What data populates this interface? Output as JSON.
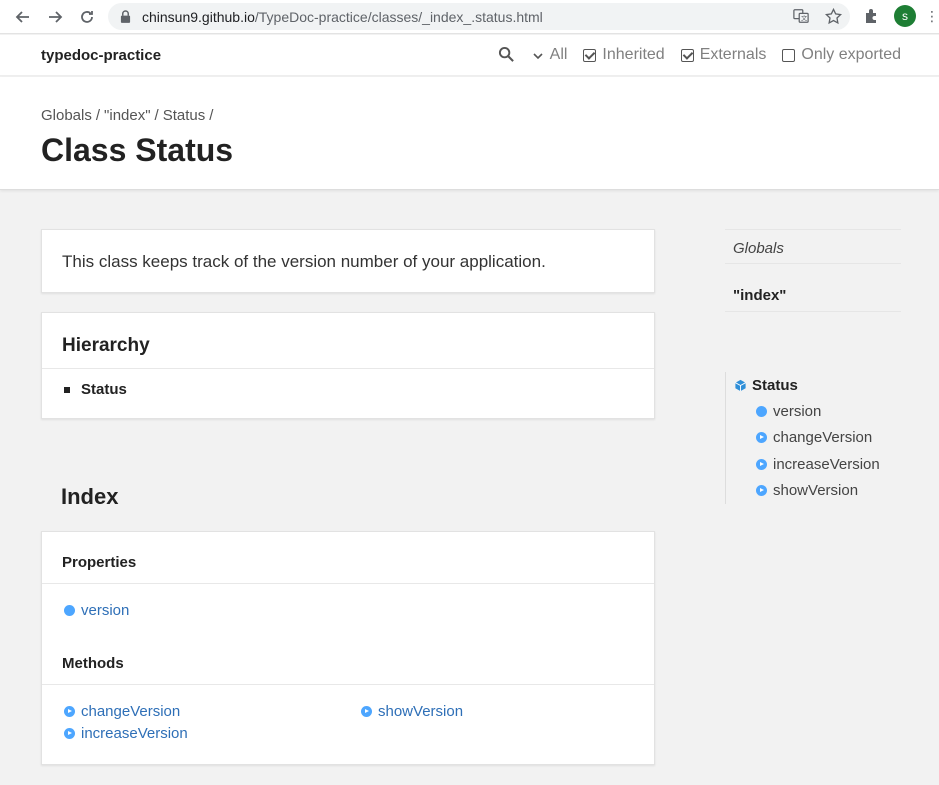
{
  "browser": {
    "url_host": "chinsun9.github.io",
    "url_path": "/TypeDoc-practice/classes/_index_.status.html",
    "avatar_letter": "s",
    "avatar_color": "#1e7e34"
  },
  "toolbar": {
    "site_title": "typedoc-practice",
    "filter_all": "All",
    "inherited": "Inherited",
    "externals": "Externals",
    "only_exported": "Only exported"
  },
  "header": {
    "breadcrumb": [
      "Globals",
      "\"index\"",
      "Status"
    ],
    "title": "Class Status"
  },
  "comment": "This class keeps track of the version number of your application.",
  "hierarchy": {
    "title": "Hierarchy",
    "items": [
      "Status"
    ]
  },
  "index": {
    "title": "Index",
    "properties_title": "Properties",
    "properties": [
      "version"
    ],
    "methods_title": "Methods",
    "methods": [
      "changeVersion",
      "increaseVersion",
      "showVersion"
    ]
  },
  "sidebar": {
    "globals": "Globals",
    "module": "\"index\"",
    "class_name": "Status",
    "members": [
      "version",
      "changeVersion",
      "increaseVersion",
      "showVersion"
    ]
  },
  "colors": {
    "link": "#2e6fb7",
    "member_icon": "#4da6ff"
  }
}
